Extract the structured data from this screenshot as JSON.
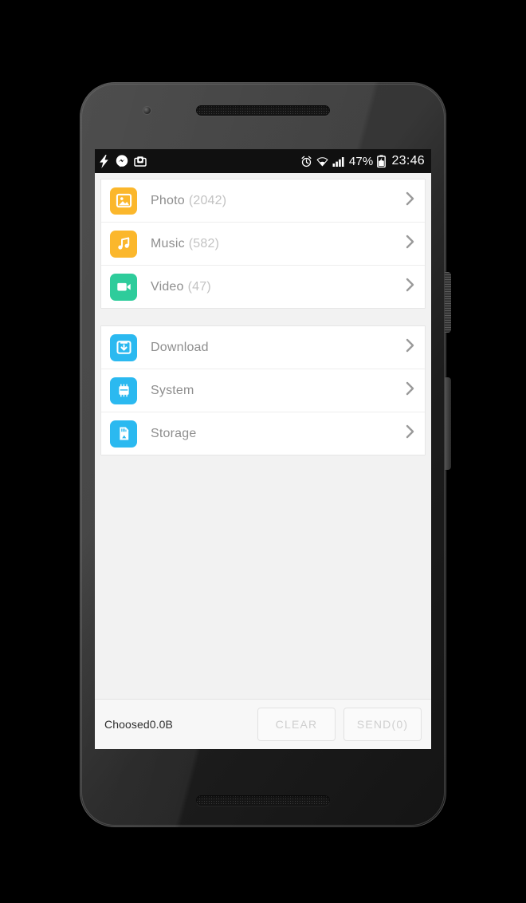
{
  "status_bar": {
    "left_icons": [
      "charging-bolt-icon",
      "messenger-icon",
      "screenshot-icon"
    ],
    "right_icons": [
      "alarm-icon",
      "wifi-icon",
      "signal-icon",
      "battery-icon"
    ],
    "battery_percent": "47%",
    "time": "23:46",
    "background": "#101010",
    "foreground": "#ffffff"
  },
  "groups": [
    {
      "rows": [
        {
          "icon": "photo-icon",
          "label": "Photo",
          "count": "(2042)",
          "color": "#fbb72c"
        },
        {
          "icon": "music-icon",
          "label": "Music",
          "count": "(582)",
          "color": "#fbb72c"
        },
        {
          "icon": "video-icon",
          "label": "Video",
          "count": "(47)",
          "color": "#2ecc9b"
        }
      ]
    },
    {
      "rows": [
        {
          "icon": "download-icon",
          "label": "Download",
          "count": "",
          "color": "#2bb9f0"
        },
        {
          "icon": "system-icon",
          "label": "System",
          "count": "",
          "color": "#2bb9f0"
        },
        {
          "icon": "storage-icon",
          "label": "Storage",
          "count": "",
          "color": "#2bb9f0"
        }
      ]
    }
  ],
  "bottom_bar": {
    "chosen_label": "Choosed0.0B",
    "clear_label": "CLEAR",
    "send_label": "SEND(0)"
  },
  "colors": {
    "page_background": "#f2f2f2",
    "card_background": "#ffffff",
    "label_text": "#8e8e8e",
    "count_text": "#c2c2c2",
    "chevron": "#9a9a9a",
    "disabled_button_text": "#cfcfcf"
  }
}
